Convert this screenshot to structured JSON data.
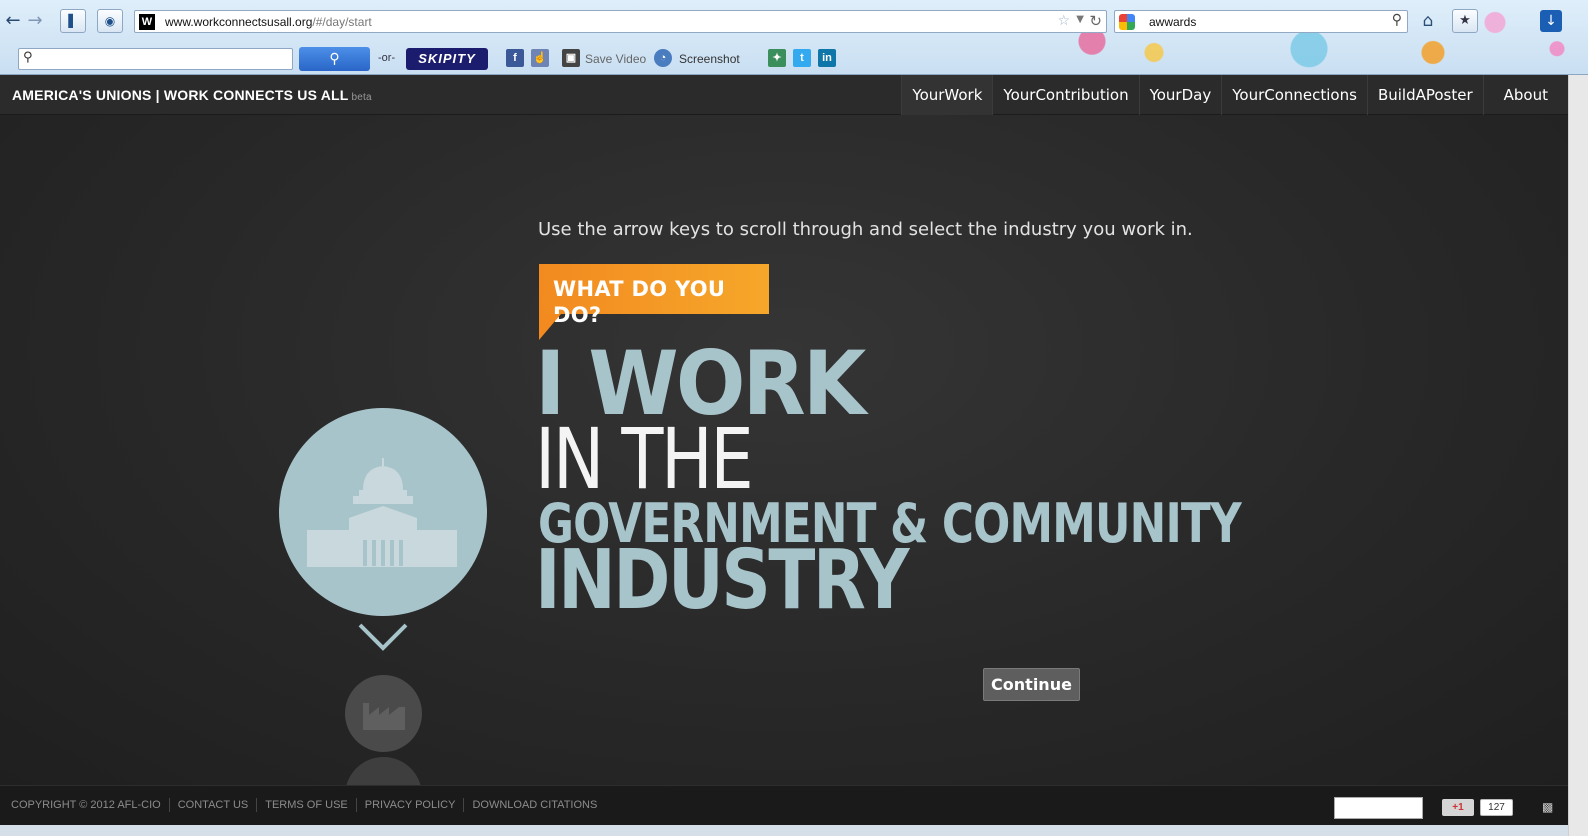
{
  "browser": {
    "url_host": "www.workconnectsusall.org",
    "url_path": "/#/day/start",
    "url_favicon": "W",
    "search_value": "awwards"
  },
  "toolbar2": {
    "or_label": "-or-",
    "skipity_label": "SKIPITY",
    "save_video_label": "Save Video",
    "screenshot_label": "Screenshot"
  },
  "header": {
    "brand": "AMERICA'S UNIONS | WORK CONNECTS US ALL",
    "beta": "beta",
    "nav": [
      "YourWork",
      "YourContribution",
      "YourDay",
      "YourConnections",
      "BuildAPoster",
      "About"
    ]
  },
  "main": {
    "instruction": "Use the arrow keys to scroll through and select the industry you work in.",
    "tag": "WHAT DO YOU DO?",
    "line1": "I WORK",
    "line2": "IN THE",
    "industry_name": "GOVERNMENT & COMMUNITY",
    "line4": "INDUSTRY",
    "continue_label": "Continue",
    "selected_icon": "capitol-building-icon",
    "next_icon": "factory-icon"
  },
  "footer": {
    "links": [
      "COPYRIGHT © 2012 AFL-CIO",
      "CONTACT US",
      "TERMS OF USE",
      "PRIVACY POLICY",
      "DOWNLOAD CITATIONS"
    ],
    "plusone_label": "+1",
    "plusone_count": "127"
  },
  "colors": {
    "accent_orange": "#f28a20",
    "industry_blue": "#a8c4cb",
    "background": "#252525"
  }
}
